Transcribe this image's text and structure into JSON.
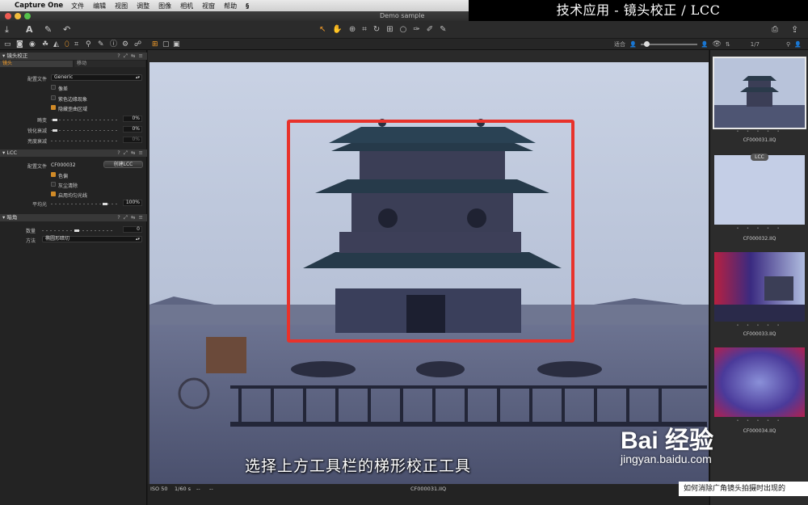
{
  "menubar": {
    "app": "Capture One",
    "items": [
      "文件",
      "编辑",
      "视图",
      "调整",
      "图像",
      "相机",
      "视窗",
      "帮助"
    ],
    "extra": "§"
  },
  "overlay_title": "技术应用 - 镜头校正 / LCC",
  "window": {
    "title": "Demo sample",
    "counter": "1/7",
    "zoom_label": "适合"
  },
  "left_panel": {
    "lens": {
      "header": "镜头校正",
      "tabs": [
        "镜头",
        "移动"
      ],
      "profile_label": "配置文件",
      "profile_value": "Generic",
      "checks": [
        {
          "label": "像差",
          "on": false
        },
        {
          "label": "紫色边缘现象",
          "on": false
        },
        {
          "label": "隐藏歪曲区域",
          "on": true
        }
      ],
      "sliders": [
        {
          "label": "畸变",
          "value": "0%"
        },
        {
          "label": "锐化衰减",
          "value": "0%"
        },
        {
          "label": "亮度衰减",
          "value": "0%"
        }
      ]
    },
    "lcc": {
      "header": "LCC",
      "profile_label": "配置文件",
      "profile_value": "CF000032",
      "create_button": "创建LCC",
      "checks": [
        {
          "label": "色偏",
          "on": true
        },
        {
          "label": "灰尘清除",
          "on": false
        },
        {
          "label": "启用均匀光线",
          "on": true
        }
      ],
      "average_label": "平均光",
      "average_value": "100%"
    },
    "vignette": {
      "header": "暗角",
      "amount_label": "数量",
      "amount_value": "0",
      "method_label": "方法",
      "method_value": "椭圆形暗切"
    }
  },
  "viewer": {
    "subtitle": "选择上方工具栏的梯形校正工具",
    "status": {
      "iso": "ISO 50",
      "shutter": "1/60 s",
      "dash1": "--",
      "dash2": "--",
      "filename": "CF000031.IIQ"
    }
  },
  "browser": {
    "thumbs": [
      {
        "label": "CF000031.IIQ",
        "stars": "• • • • •"
      },
      {
        "label": "CF000032.IIQ",
        "stars": "• • • • •"
      },
      {
        "label": "CF000033.IIQ",
        "stars": "• • • • •"
      },
      {
        "label": "CF000034.IIQ",
        "stars": "• • • • •"
      }
    ],
    "badge": "LCC"
  },
  "watermark": {
    "logo": "Bai 经验",
    "url": "jingyan.baidu.com"
  },
  "bottom_caption": "如何消除广角镜头拍摄时出现的",
  "colors": {
    "accent": "#f29c2a",
    "highlight_box": "#e8322b"
  }
}
